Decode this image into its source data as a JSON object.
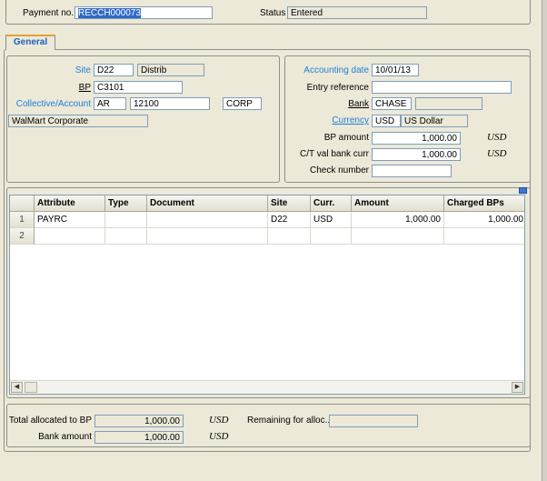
{
  "header": {
    "payment_no_label": "Payment no.",
    "payment_no_value": "RECCH000073",
    "status_label": "Status",
    "status_value": "Entered"
  },
  "tabs": [
    {
      "label": "General",
      "active": true
    }
  ],
  "left_panel": {
    "site_label": "Site",
    "site_code": "D22",
    "site_name": "Distrib",
    "bp_label": "BP",
    "bp_value": "C3101",
    "collective_label": "Collective/Account",
    "collective_value": "AR",
    "account_value": "12100",
    "account_extra": "CORP",
    "customer_name": "WalMart Corporate"
  },
  "right_panel": {
    "accounting_date_label": "Accounting date",
    "accounting_date_value": "10/01/13",
    "entry_reference_label": "Entry reference",
    "entry_reference_value": "",
    "bank_label": "Bank",
    "bank_code": "CHASE",
    "bank_name": "",
    "currency_label": "Currency",
    "currency_code": "USD",
    "currency_name": "US Dollar",
    "bp_amount_label": "BP amount",
    "bp_amount_value": "1,000.00",
    "bp_amount_currency": "USD",
    "ct_val_label": "C/T val bank curr",
    "ct_val_value": "1,000.00",
    "ct_val_currency": "USD",
    "check_number_label": "Check number",
    "check_number_value": ""
  },
  "grid": {
    "columns": [
      "Attribute",
      "Type",
      "Document",
      "Site",
      "Curr.",
      "Amount",
      "Charged BPs"
    ],
    "rows": [
      {
        "num": "1",
        "attribute": "PAYRC",
        "type": "",
        "document": "",
        "site": "D22",
        "curr": "USD",
        "amount": "1,000.00",
        "charged": "1,000.00"
      },
      {
        "num": "2",
        "attribute": "",
        "type": "",
        "document": "",
        "site": "",
        "curr": "",
        "amount": "",
        "charged": ""
      }
    ]
  },
  "footer": {
    "total_allocated_label": "Total allocated to BP",
    "total_allocated_value": "1,000.00",
    "total_allocated_currency": "USD",
    "remaining_label": "Remaining for alloc...",
    "remaining_value": "",
    "bank_amount_label": "Bank amount",
    "bank_amount_value": "1,000.00",
    "bank_amount_currency": "USD"
  },
  "colors": {
    "window_bg": "#ece9d8",
    "link_blue": "#1e7fd8",
    "field_border": "#7f9db9",
    "tab_accent": "#e6a035",
    "selection": "#316ac5"
  }
}
